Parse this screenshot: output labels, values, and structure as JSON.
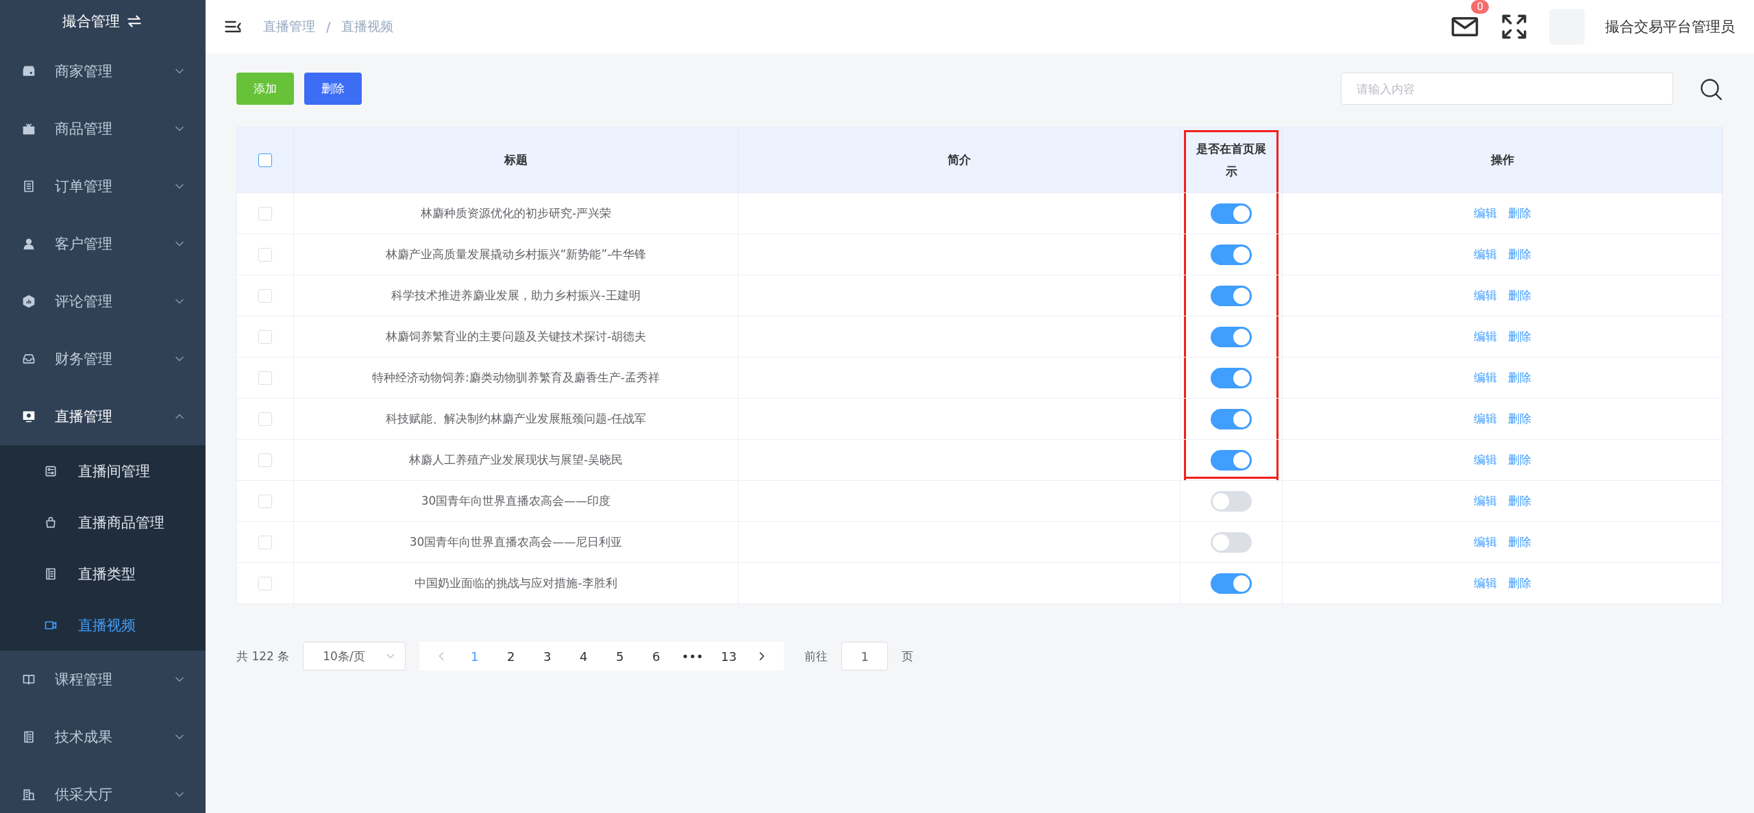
{
  "sidebar": {
    "title": "撮合管理",
    "items": [
      {
        "label": "商家管理",
        "expanded": false
      },
      {
        "label": "商品管理",
        "expanded": false
      },
      {
        "label": "订单管理",
        "expanded": false
      },
      {
        "label": "客户管理",
        "expanded": false
      },
      {
        "label": "评论管理",
        "expanded": false
      },
      {
        "label": "财务管理",
        "expanded": false
      },
      {
        "label": "直播管理",
        "expanded": true,
        "children": [
          {
            "label": "直播间管理",
            "selected": false
          },
          {
            "label": "直播商品管理",
            "selected": false
          },
          {
            "label": "直播类型",
            "selected": false
          },
          {
            "label": "直播视频",
            "selected": true
          }
        ]
      },
      {
        "label": "课程管理",
        "expanded": false
      },
      {
        "label": "技术成果",
        "expanded": false
      },
      {
        "label": "供采大厅",
        "expanded": false
      }
    ]
  },
  "header": {
    "breadcrumb": [
      "直播管理",
      "直播视频"
    ],
    "breadcrumb_separator": "/",
    "mail_badge": "0",
    "user": "撮合交易平台管理员"
  },
  "toolbar": {
    "buttons": [
      {
        "label": "添加",
        "kind": "add"
      },
      {
        "label": "删除",
        "kind": "delete"
      }
    ],
    "search": {
      "placeholder": "请输入内容"
    }
  },
  "table": {
    "columns": [
      "标题",
      "简介",
      "是否在首页展示",
      "操作"
    ],
    "select_all_checked": false,
    "rows": [
      {
        "checked": false,
        "title": "林麝种质资源优化的初步研究-严兴荣",
        "show_on_home": true,
        "highlighted": true,
        "actions": [
          "编辑",
          "删除"
        ]
      },
      {
        "checked": false,
        "title": "林麝产业高质量发展撬动乡村振兴“新势能”-牛华锋",
        "show_on_home": true,
        "highlighted": true,
        "actions": [
          "编辑",
          "删除"
        ]
      },
      {
        "checked": false,
        "title": "科学技术推进养麝业发展，助力乡村振兴-王建明",
        "show_on_home": true,
        "highlighted": true,
        "actions": [
          "编辑",
          "删除"
        ]
      },
      {
        "checked": false,
        "title": "林麝饲养繁育业的主要问题及关键技术探讨-胡德夫",
        "show_on_home": true,
        "highlighted": true,
        "actions": [
          "编辑",
          "删除"
        ]
      },
      {
        "checked": false,
        "title": "特种经济动物饲养:麝类动物驯养繁育及麝香生产-孟秀祥",
        "show_on_home": true,
        "highlighted": true,
        "actions": [
          "编辑",
          "删除"
        ]
      },
      {
        "checked": false,
        "title": "科技赋能、解决制约林麝产业发展瓶颈问题-任战军",
        "show_on_home": true,
        "highlighted": true,
        "actions": [
          "编辑",
          "删除"
        ]
      },
      {
        "checked": false,
        "title": "林麝人工养殖产业发展现状与展望-吴晓民",
        "show_on_home": true,
        "highlighted": true,
        "actions": [
          "编辑",
          "删除"
        ]
      },
      {
        "checked": false,
        "title": "30国青年向世界直播农高会——印度",
        "show_on_home": false,
        "highlighted": false,
        "actions": [
          "编辑",
          "删除"
        ]
      },
      {
        "checked": false,
        "title": "30国青年向世界直播农高会——尼日利亚",
        "show_on_home": false,
        "highlighted": false,
        "actions": [
          "编辑",
          "删除"
        ]
      },
      {
        "checked": false,
        "title": "中国奶业面临的挑战与应对措施-李胜利",
        "show_on_home": true,
        "highlighted": false,
        "actions": [
          "编辑",
          "删除"
        ]
      }
    ]
  },
  "pagination": {
    "total": "共 122 条",
    "page_size": "10条/页",
    "pages": [
      {
        "label": "1",
        "selected": true
      },
      {
        "label": "2",
        "selected": false
      },
      {
        "label": "3",
        "selected": false
      },
      {
        "label": "4",
        "selected": false
      },
      {
        "label": "5",
        "selected": false
      },
      {
        "label": "6",
        "selected": false
      },
      {
        "label": "•••",
        "selected": false
      },
      {
        "label": "13",
        "selected": false
      }
    ],
    "jump_label": "前往",
    "jump_value": "1",
    "jump_suffix": "页"
  }
}
